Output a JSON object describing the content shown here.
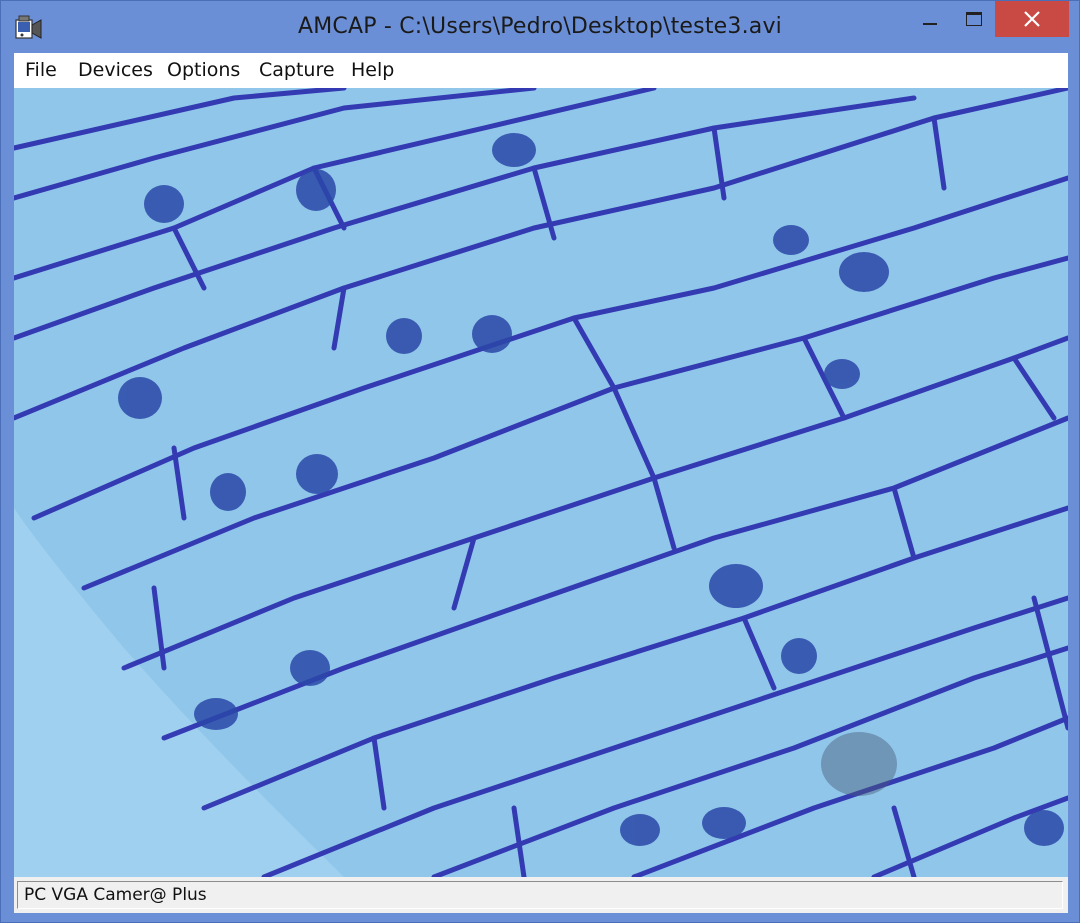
{
  "window": {
    "title": "AMCAP - C:\\Users\\Pedro\\Desktop\\teste3.avi",
    "icon": "camera-app-icon",
    "controls": {
      "minimize": "minimize-icon",
      "maximize": "maximize-icon",
      "close": "close-icon"
    },
    "colors": {
      "frame": "#6b8fd6",
      "close": "#c94a44"
    }
  },
  "menu": {
    "items": [
      {
        "label": "File"
      },
      {
        "label": "Devices"
      },
      {
        "label": "Options"
      },
      {
        "label": "Capture"
      },
      {
        "label": "Help"
      }
    ]
  },
  "preview": {
    "colors": {
      "background": "#8fc6ea",
      "cell_wall": "#2a2aa8",
      "nucleus": "#2c48a8"
    }
  },
  "status": {
    "text": "PC VGA Camer@ Plus"
  }
}
